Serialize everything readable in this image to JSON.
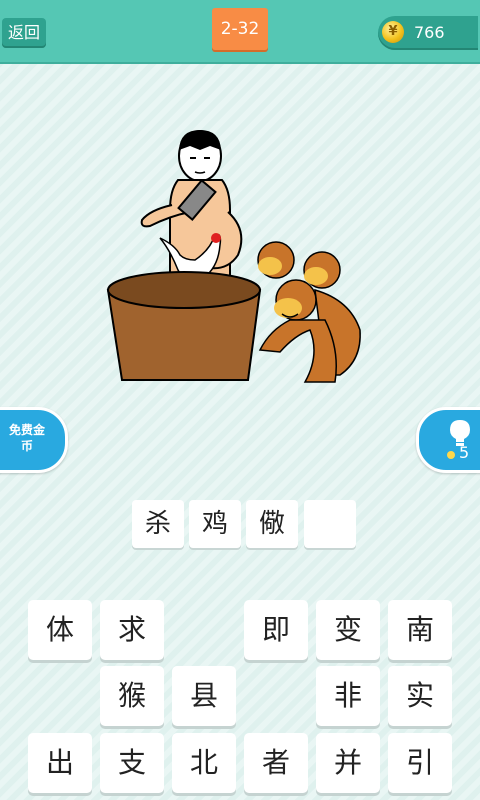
{
  "header": {
    "back_label": "返回",
    "level": "2-32",
    "coins": "766"
  },
  "side": {
    "free_coins_label": "免费金币",
    "hint_count": "5"
  },
  "answer": [
    "杀",
    "鸡",
    "儆",
    ""
  ],
  "keyboard": {
    "row1": [
      "体",
      "求",
      "",
      "即",
      "变",
      "南"
    ],
    "row2": [
      "",
      "猴",
      "县",
      "",
      "非",
      "实"
    ],
    "row3": [
      "出",
      "支",
      "北",
      "者",
      "并",
      "引"
    ]
  },
  "colors": {
    "header": "#55c7b4",
    "level_badge": "#f88c45",
    "side_buttons": "#29a9e0"
  }
}
